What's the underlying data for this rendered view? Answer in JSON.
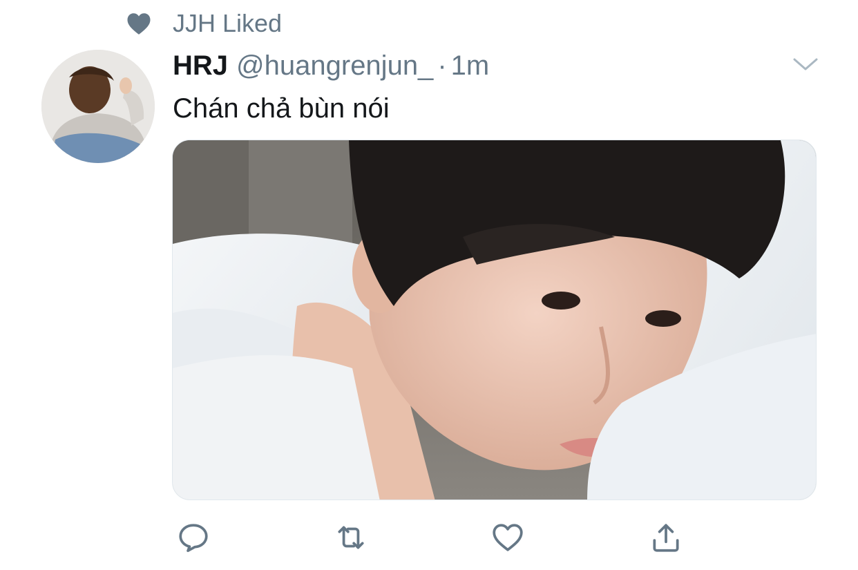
{
  "social_context": {
    "icon": "heart-icon",
    "text": "JJH Liked"
  },
  "tweet": {
    "display_name": "HRJ",
    "handle": "@huangrenjun_",
    "separator": "·",
    "timestamp": "1m",
    "text": "Chán chả bùn nói",
    "avatar": "avatar-image",
    "media": "photo"
  },
  "actions": [
    {
      "name": "reply-icon"
    },
    {
      "name": "retweet-icon"
    },
    {
      "name": "like-icon"
    },
    {
      "name": "share-icon"
    }
  ],
  "colors": {
    "primary_text": "#14171a",
    "secondary_text": "#657786",
    "border": "#e1e8ed"
  }
}
